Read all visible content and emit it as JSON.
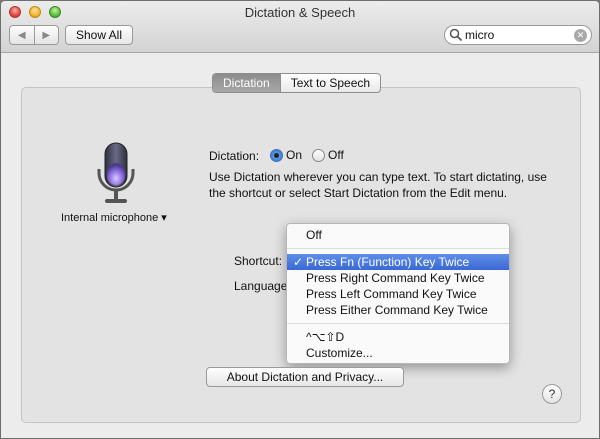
{
  "window": {
    "title": "Dictation & Speech"
  },
  "toolbar": {
    "back_glyph": "◀",
    "forward_glyph": "▶",
    "show_all_label": "Show All",
    "search_value": "micro"
  },
  "tabs": [
    {
      "label": "Dictation",
      "active": true
    },
    {
      "label": "Text to Speech",
      "active": false
    }
  ],
  "microphone": {
    "label": "Internal microphone ▾",
    "icon": "microphone-icon"
  },
  "dictation": {
    "label": "Dictation:",
    "on_label": "On",
    "off_label": "Off",
    "selected": "On",
    "description": "Use Dictation wherever you can type text. To start dictating, use the shortcut or select Start Dictation from the Edit menu."
  },
  "shortcut": {
    "label": "Shortcut:"
  },
  "language": {
    "label": "Language"
  },
  "shortcut_menu": {
    "item_off": "Off",
    "item_fn": "Press Fn (Function) Key Twice",
    "item_right_cmd": "Press Right Command Key Twice",
    "item_left_cmd": "Press Left Command Key Twice",
    "item_either_cmd": "Press Either Command Key Twice",
    "item_custom_keys": "^⌥⇧D",
    "item_customize": "Customize...",
    "checkmark": "✓"
  },
  "about_button": {
    "label": "About Dictation and Privacy..."
  },
  "help_button": {
    "label": "?"
  }
}
